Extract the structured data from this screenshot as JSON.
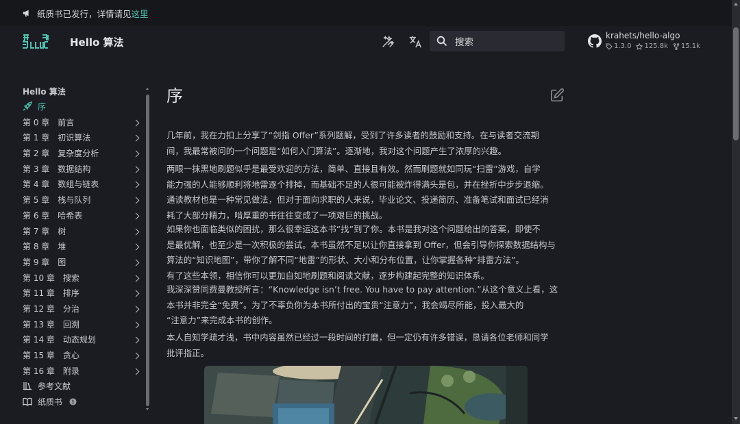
{
  "announcement": {
    "text": "纸质书已发行，详情请见",
    "link": "这里"
  },
  "header": {
    "site_title": "Hello 算法",
    "search_placeholder": "搜索",
    "repo": {
      "name": "krahets/hello-algo",
      "version": "1.3.0",
      "stars": "125.8k",
      "forks": "15.1k"
    }
  },
  "sidebar": {
    "heading": "Hello 算法",
    "items": [
      {
        "label": "序",
        "icon": "rocket-icon",
        "active": true
      },
      {
        "label": "第 0 章　前言"
      },
      {
        "label": "第 1 章　初识算法"
      },
      {
        "label": "第 2 章　复杂度分析"
      },
      {
        "label": "第 3 章　数据结构"
      },
      {
        "label": "第 4 章　数组与链表"
      },
      {
        "label": "第 5 章　栈与队列"
      },
      {
        "label": "第 6 章　哈希表"
      },
      {
        "label": "第 7 章　树"
      },
      {
        "label": "第 8 章　堆"
      },
      {
        "label": "第 9 章　图"
      },
      {
        "label": "第 10 章　搜索"
      },
      {
        "label": "第 11 章　排序"
      },
      {
        "label": "第 12 章　分治"
      },
      {
        "label": "第 13 章　回溯"
      },
      {
        "label": "第 14 章　动态规划"
      },
      {
        "label": "第 15 章　贪心"
      },
      {
        "label": "第 16 章　附录"
      },
      {
        "label": "参考文献",
        "icon": "books-icon"
      },
      {
        "label": "纸质书",
        "icon": "book-open-icon",
        "badge": true
      }
    ]
  },
  "main": {
    "title": "序",
    "lines": [
      [
        "几年前，我在力扣上分享了“剑指 Offer”系列题解，受到了许多读者的鼓励和支持。在与读者交流期",
        "间，我最常被问的一个问题是“如何入门算法”。逐渐地，我对这个问题产生了浓厚的兴趣。"
      ],
      [
        "两眼一抹黑地刷题似乎是最受欢迎的方法，简单、直接且有效。然而刷题就如同玩“扫雷”游戏，自学",
        "能力强的人能够顺利将地雷逐个排掉，而基础不足的人很可能被炸得满头是包，并在挫折中步步退缩。",
        "通读教材也是一种常见做法，但对于面向求职的人来说，毕业论文、投递简历、准备笔试和面试已经消",
        "耗了大部分精力，啃厚重的书往往变成了一项艰巨的挑战。"
      ],
      [
        "如果你也面临类似的困扰，那么很幸运这本书“找”到了你。本书是我对这个问题给出的答案，即使不",
        "是最优解，也至少是一次积极的尝试。本书虽然不足以让你直接拿到 Offer，但会引导你探索数据结构与",
        "算法的“知识地图”，带你了解不同“地雷”的形状、大小和分布位置，让你掌握各种“排雷方法”。",
        "有了这些本领，相信你可以更加自如地刷题和阅读文献，逐步构建起完整的知识体系。"
      ],
      [
        "我深深赞同费曼教授所言：“Knowledge isn’t free. You have to pay attention.”从这个意义上看，这",
        "本书并非完全“免费”。为了不辜负你为本书所付出的宝贵“注意力”，我会竭尽所能，投入最大的",
        "“注意力”来完成本书的创作。"
      ],
      [
        "本人自知学疏才浅，书中内容虽然已经过一段时间的打磨，但一定仍有许多错误，恳请各位老师和同学",
        "批评指正。"
      ]
    ]
  },
  "colors": {
    "accent": "#4fc1b1",
    "background": "#1b1c22",
    "announce_bg": "#16171b"
  }
}
